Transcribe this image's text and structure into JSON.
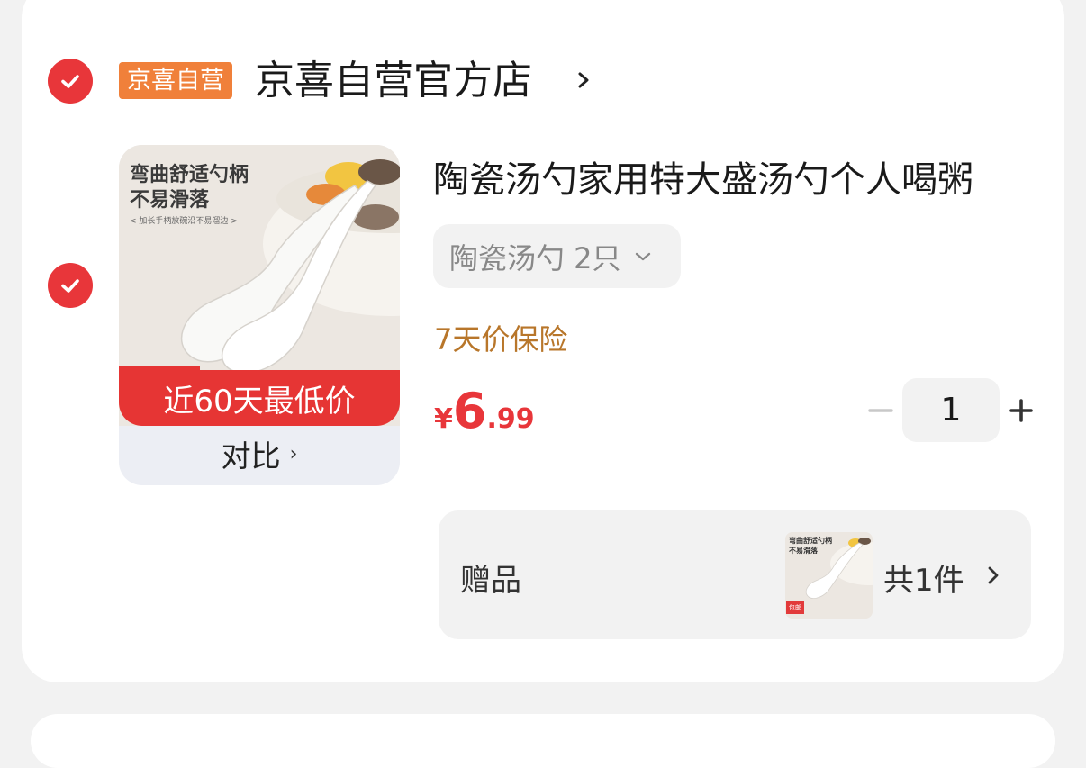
{
  "store": {
    "badge": "京喜自营",
    "name": "京喜自营官方店",
    "selected": true
  },
  "item": {
    "selected": true,
    "title": "陶瓷汤勺家用特大盛汤勺个人喝粥",
    "image_caption_line1": "弯曲舒适勺柄",
    "image_caption_line2": "不易滑落",
    "image_caption_small": "< 加长手柄放碗沿不易溜边 >",
    "low_price_banner": "近60天最低价",
    "compare_label": "对比",
    "spec": "陶瓷汤勺 2只",
    "insurance": "7天价保险",
    "price_currency": "¥",
    "price_integer": "6",
    "price_decimal": ".99",
    "quantity": "1"
  },
  "gift": {
    "label": "赠品",
    "thumb_caption_line1": "弯曲舒适勺柄",
    "thumb_caption_line2": "不易滑落",
    "thumb_tag": "包邮",
    "count": "共1件"
  },
  "colors": {
    "accent_red": "#e8363a",
    "badge_orange": "#f0803a",
    "insurance_brown": "#b8762a"
  }
}
